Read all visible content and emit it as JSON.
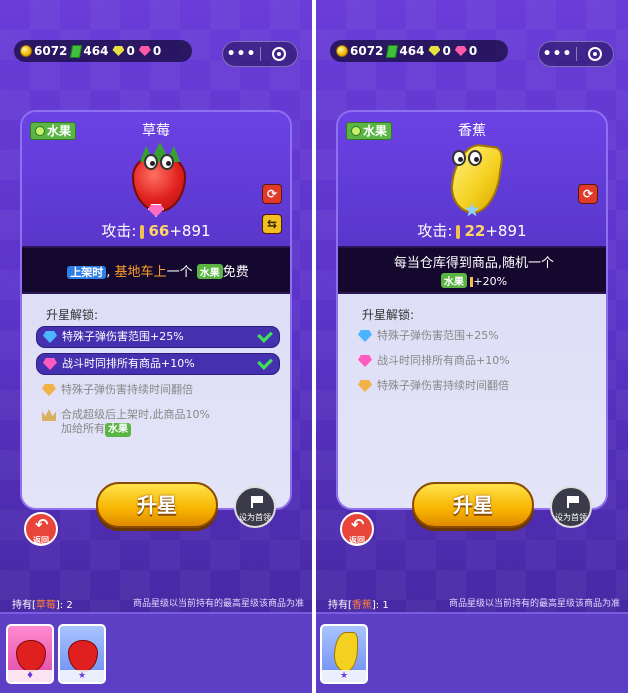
{
  "resources": {
    "coins": "6072",
    "cash": "464",
    "green_gems": "0",
    "pink_gems": "0"
  },
  "capsule": {
    "more": "•••"
  },
  "panels": [
    {
      "category": "水果",
      "item_name": "草莓",
      "attack_label": "攻击:",
      "attack_base": "66",
      "attack_bonus": "+891",
      "skill_line1_tag": "上架时",
      "skill_line1_sep": ",",
      "skill_line1_highlight": "基地车上",
      "skill_line1_mid": "一个",
      "skill_line1_end": "免费",
      "unlock_title": "升星解锁:",
      "unlocks": [
        {
          "text": "特殊子弹伤害范围+25%",
          "icon": "blue-diamond-icon",
          "done": true
        },
        {
          "text": "战斗时同排所有商品+10%",
          "icon": "pink-diamond-icon",
          "done": true
        },
        {
          "text": "特殊子弹伤害持续时间翻倍",
          "icon": "gold-diamond-icon",
          "done": false
        },
        {
          "text": "合成超级后上架时,此商品10%",
          "text2": "加给所有",
          "icon": "crown-icon",
          "done": false
        }
      ],
      "star_up": "升星",
      "set_first": "设为首领",
      "back": "返回",
      "holding_prefix": "持有[",
      "holding_name": "草莓",
      "holding_suffix": "]: 2",
      "note": "商品星级以当前持有的最高星级该商品为准",
      "slots": [
        {
          "badge": "♦"
        },
        {
          "badge": "★"
        }
      ]
    },
    {
      "category": "水果",
      "item_name": "香蕉",
      "attack_label": "攻击:",
      "attack_base": "22",
      "attack_bonus": "+891",
      "skill_line1": "每当仓库得到商品,随机一个",
      "skill_line2_end": "+20%",
      "unlock_title": "升星解锁:",
      "unlocks": [
        {
          "text": "特殊子弹伤害范围+25%",
          "icon": "blue-diamond-icon",
          "done": false
        },
        {
          "text": "战斗时同排所有商品+10%",
          "icon": "pink-diamond-icon",
          "done": false
        },
        {
          "text": "特殊子弹伤害持续时间翻倍",
          "icon": "gold-diamond-icon",
          "done": false
        }
      ],
      "star_up": "升星",
      "set_first": "设为首领",
      "back": "返回",
      "holding_prefix": "持有[",
      "holding_name": "香蕉",
      "holding_suffix": "]: 1",
      "note": "商品星级以当前持有的最高星级该商品为准",
      "slots": [
        {
          "badge": "★"
        }
      ]
    }
  ]
}
